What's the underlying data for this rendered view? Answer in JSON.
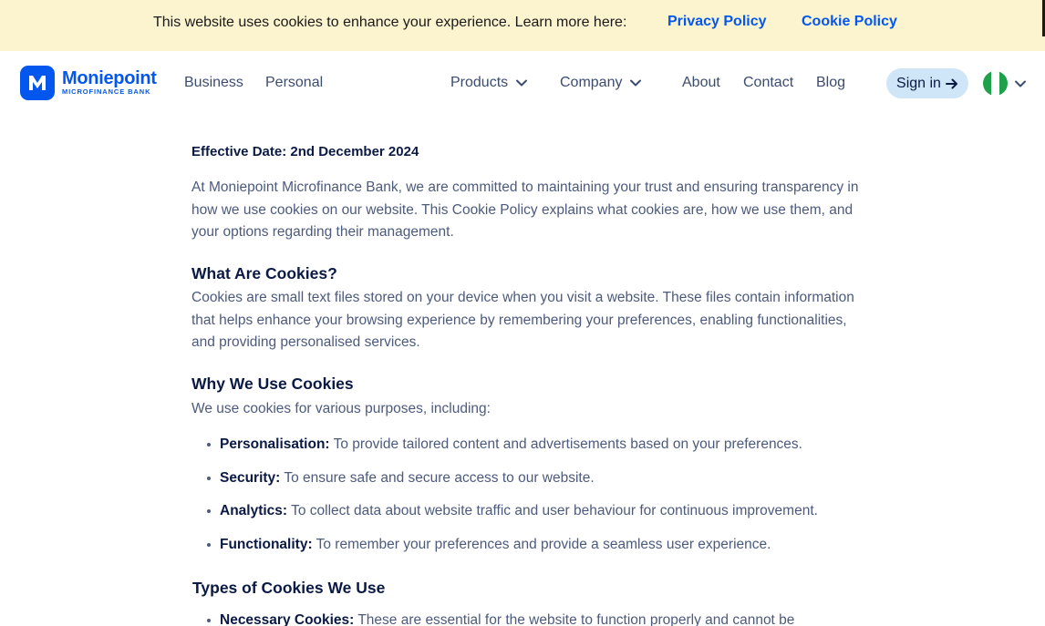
{
  "cookie_banner": {
    "text": "This website uses cookies to enhance your experience. Learn more here:",
    "privacy_link": "Privacy Policy",
    "cookie_link": "Cookie Policy"
  },
  "logo": {
    "letter": "M",
    "name": "Moniepoint",
    "subtitle": "MICROFINANCE BANK"
  },
  "nav": {
    "business": "Business",
    "personal": "Personal",
    "products": "Products",
    "company": "Company",
    "about": "About",
    "contact": "Contact",
    "blog": "Blog",
    "sign_in": "Sign in"
  },
  "colors": {
    "brand_blue": "#0357ee",
    "banner_bg": "#fcf3cf",
    "flag_green": "#1fa04a",
    "signin_bg": "#cfe6f8"
  },
  "content": {
    "effective_date": "Effective Date: 2nd December 2024",
    "intro": "At Moniepoint Microfinance Bank, we are committed to maintaining your trust and ensuring transparency in how we use cookies on our website. This Cookie Policy explains what cookies are, how we use them, and your options regarding their management.",
    "what_heading": "What Are Cookies?",
    "what_text": "Cookies are small text files stored on your device when you visit a website. These files contain information that helps enhance your browsing experience by remembering your preferences, enabling functionalities, and providing personalised services.",
    "why_heading": "Why We Use Cookies",
    "why_text": "We use cookies for various purposes, including:",
    "why_items": [
      {
        "label": "Personalisation:",
        "text": "To provide tailored content and advertisements based on your preferences."
      },
      {
        "label": "Security:",
        "text": "To ensure safe and secure access to our website."
      },
      {
        "label": "Analytics:",
        "text": "To collect data about website traffic and user behaviour for continuous improvement."
      },
      {
        "label": "Functionality:",
        "text": "To remember your preferences and provide a seamless user experience."
      }
    ],
    "types_heading": "Types of Cookies We Use",
    "types_items": [
      {
        "label": "Necessary Cookies:",
        "text": "These are essential for the website to function properly and cannot be"
      }
    ]
  }
}
